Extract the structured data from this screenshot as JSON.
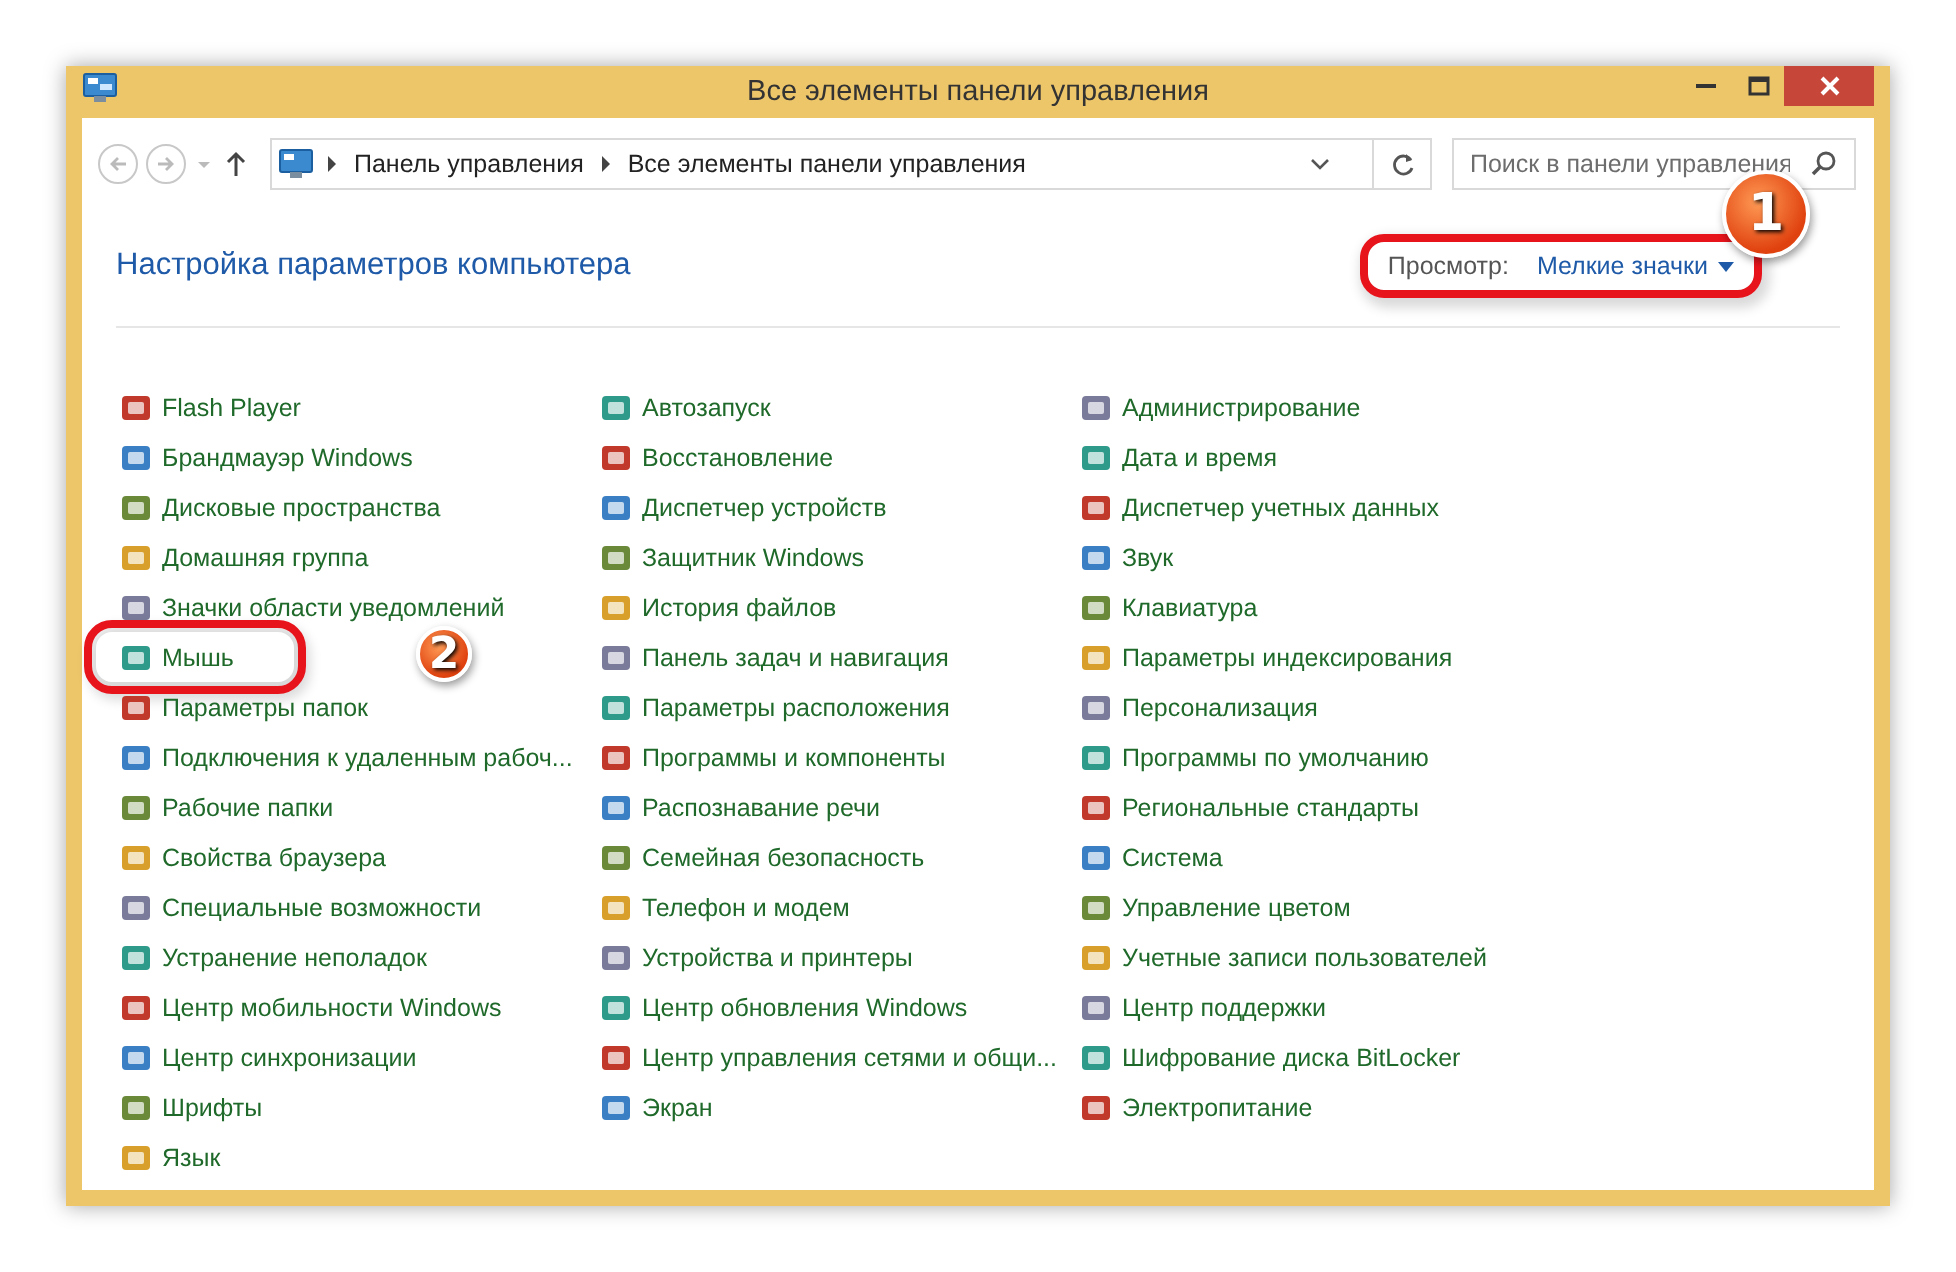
{
  "window": {
    "title": "Все элементы панели управления"
  },
  "address_bar": {
    "crumbs": [
      "Панель управления",
      "Все элементы панели управления"
    ]
  },
  "search": {
    "placeholder": "Поиск в панели управления"
  },
  "heading": "Настройка параметров компьютера",
  "view": {
    "label": "Просмотр:",
    "value": "Мелкие значки",
    "highlighted": true,
    "badge": "1"
  },
  "columns": [
    [
      {
        "label": "Flash Player"
      },
      {
        "label": "Брандмауэр Windows"
      },
      {
        "label": "Дисковые пространства"
      },
      {
        "label": "Домашняя группа"
      },
      {
        "label": "Значки области уведомлений"
      },
      {
        "label": "Мышь",
        "highlighted": true,
        "badge": "2"
      },
      {
        "label": "Параметры папок"
      },
      {
        "label": "Подключения к удаленным рабоч..."
      },
      {
        "label": "Рабочие папки"
      },
      {
        "label": "Свойства браузера"
      },
      {
        "label": "Специальные возможности"
      },
      {
        "label": "Устранение неполадок"
      },
      {
        "label": "Центр мобильности Windows"
      },
      {
        "label": "Центр синхронизации"
      },
      {
        "label": "Шрифты"
      },
      {
        "label": "Язык"
      }
    ],
    [
      {
        "label": "Автозапуск"
      },
      {
        "label": "Восстановление"
      },
      {
        "label": "Диспетчер устройств"
      },
      {
        "label": "Защитник Windows"
      },
      {
        "label": "История файлов"
      },
      {
        "label": "Панель задач и навигация"
      },
      {
        "label": "Параметры расположения"
      },
      {
        "label": "Программы и компоненты"
      },
      {
        "label": "Распознавание речи"
      },
      {
        "label": "Семейная безопасность"
      },
      {
        "label": "Телефон и модем"
      },
      {
        "label": "Устройства и принтеры"
      },
      {
        "label": "Центр обновления Windows"
      },
      {
        "label": "Центр управления сетями и общи..."
      },
      {
        "label": "Экран"
      }
    ],
    [
      {
        "label": "Администрирование"
      },
      {
        "label": "Дата и время"
      },
      {
        "label": "Диспетчер учетных данных"
      },
      {
        "label": "Звук"
      },
      {
        "label": "Клавиатура"
      },
      {
        "label": "Параметры индексирования"
      },
      {
        "label": "Персонализация"
      },
      {
        "label": "Программы по умолчанию"
      },
      {
        "label": "Региональные стандарты"
      },
      {
        "label": "Система"
      },
      {
        "label": "Управление цветом"
      },
      {
        "label": "Учетные записи пользователей"
      },
      {
        "label": "Центр поддержки"
      },
      {
        "label": "Шифрование диска BitLocker"
      },
      {
        "label": "Электропитание"
      }
    ]
  ]
}
